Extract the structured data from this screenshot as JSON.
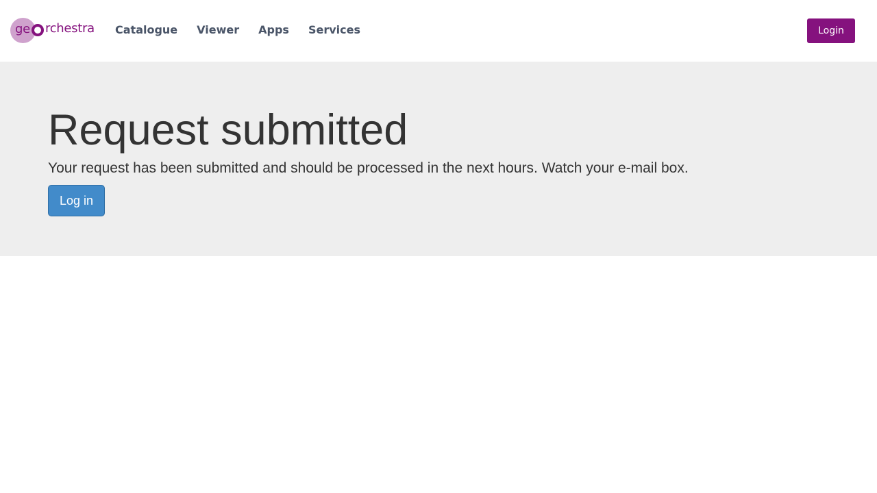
{
  "header": {
    "logo": {
      "text_prefix": "ge",
      "text_suffix": "rchestra"
    },
    "nav": [
      {
        "label": "Catalogue"
      },
      {
        "label": "Viewer"
      },
      {
        "label": "Apps"
      },
      {
        "label": "Services"
      }
    ],
    "login_label": "Login"
  },
  "main": {
    "title": "Request submitted",
    "message": "Your request has been submitted and should be processed in the next hours. Watch your e-mail box.",
    "login_button_label": "Log in"
  },
  "colors": {
    "brand_purple": "#85127e",
    "brand_light_purple": "#cfa2cd",
    "nav_text": "#4a5568",
    "jumbotron_bg": "#eeeeee",
    "primary_button": "#428bca"
  }
}
